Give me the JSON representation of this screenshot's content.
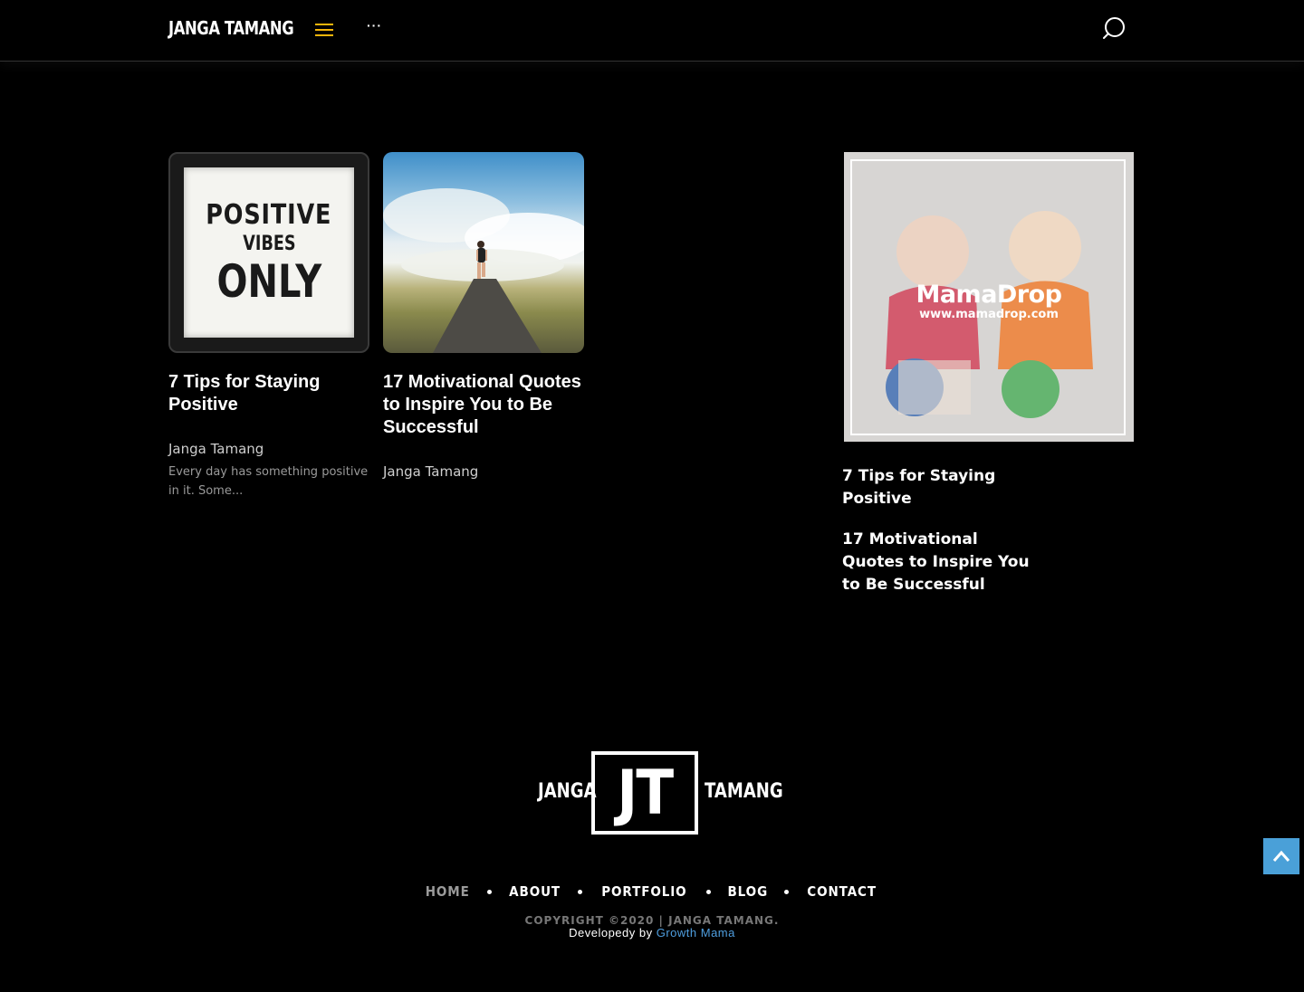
{
  "header": {
    "site_title": "JANGA TAMANG",
    "more_label": "···",
    "accent_color": "#f5b50a"
  },
  "posts": [
    {
      "title": "7 Tips for Staying Positive",
      "author": "Janga Tamang",
      "excerpt": "Every day has something positive in it. Some...",
      "image_text": [
        "POSITIVE",
        "VIBES",
        "ONLY"
      ]
    },
    {
      "title": "17 Motivational Quotes to Inspire You to Be Successful",
      "author": "Janga Tamang"
    }
  ],
  "ad": {
    "brand": "MamaDrop",
    "url": "www.mamadrop.com"
  },
  "sidebar": {
    "links": [
      "7 Tips for Staying Positive",
      "17 Motivational Quotes to Inspire You to Be Successful"
    ]
  },
  "footer": {
    "logo_left": "JANGA",
    "logo_mark": "JT",
    "logo_right": "TAMANG",
    "nav": [
      "HOME",
      "ABOUT",
      "PORTFOLIO",
      "BLOG",
      "CONTACT"
    ],
    "copyright": "COPYRIGHT ©2020 | JANGA TAMANG.",
    "developed_prefix": "Developedy by",
    "developer_name": "Growth Mama",
    "developer_color": "#4f9fe0"
  },
  "back_to_top_color": "#4aa0d8"
}
